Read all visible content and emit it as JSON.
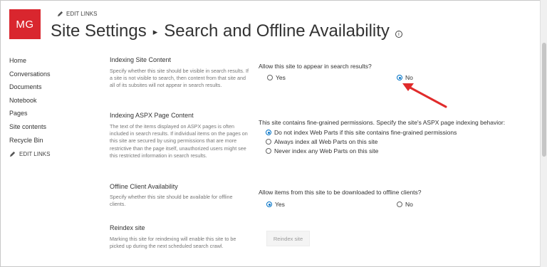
{
  "header": {
    "logo_text": "MG",
    "edit_links": "EDIT LINKS",
    "title_parent": "Site Settings",
    "title_separator": "▸",
    "title_page": "Search and Offline Availability",
    "info_icon": "i"
  },
  "nav": {
    "items": [
      "Home",
      "Conversations",
      "Documents",
      "Notebook",
      "Pages",
      "Site contents",
      "Recycle Bin"
    ],
    "edit_links": "EDIT LINKS"
  },
  "sections": {
    "indexing": {
      "title": "Indexing Site Content",
      "description": "Specify whether this site should be visible in search results. If a site is not visible to search, then content from that site and all of its subsites will not appear in search results.",
      "question": "Allow this site to appear in search results?",
      "options": [
        "Yes",
        "No"
      ],
      "selected": "No"
    },
    "aspx": {
      "title": "Indexing ASPX Page Content",
      "description": "The text of the items displayed on ASPX pages is often included in search results. If individual items on the pages on this site are secured by using permissions that are more restrictive than the page itself, unauthorized users might see this restricted information in search results.",
      "question": "This site contains fine-grained permissions. Specify the site's ASPX page indexing behavior:",
      "options": [
        "Do not index Web Parts if this site contains fine-grained permissions",
        "Always index all Web Parts on this site",
        "Never index any Web Parts on this site"
      ],
      "selected": "Do not index Web Parts if this site contains fine-grained permissions"
    },
    "offline": {
      "title": "Offline Client Availability",
      "description": "Specify whether this site should be available for offline clients.",
      "question": "Allow items from this site to be downloaded to offline clients?",
      "options": [
        "Yes",
        "No"
      ],
      "selected": "Yes"
    },
    "reindex": {
      "title": "Reindex site",
      "description": "Marking this site for reindexing will enable this site to be picked up during the next scheduled search crawl.",
      "button_label": "Reindex site"
    }
  },
  "colors": {
    "logo_bg": "#d9262e",
    "radio_selected": "#0072c6",
    "annotation_arrow": "#e02b2b"
  },
  "icons": [
    "pencil-icon",
    "info-icon",
    "annotation-arrow-icon"
  ]
}
